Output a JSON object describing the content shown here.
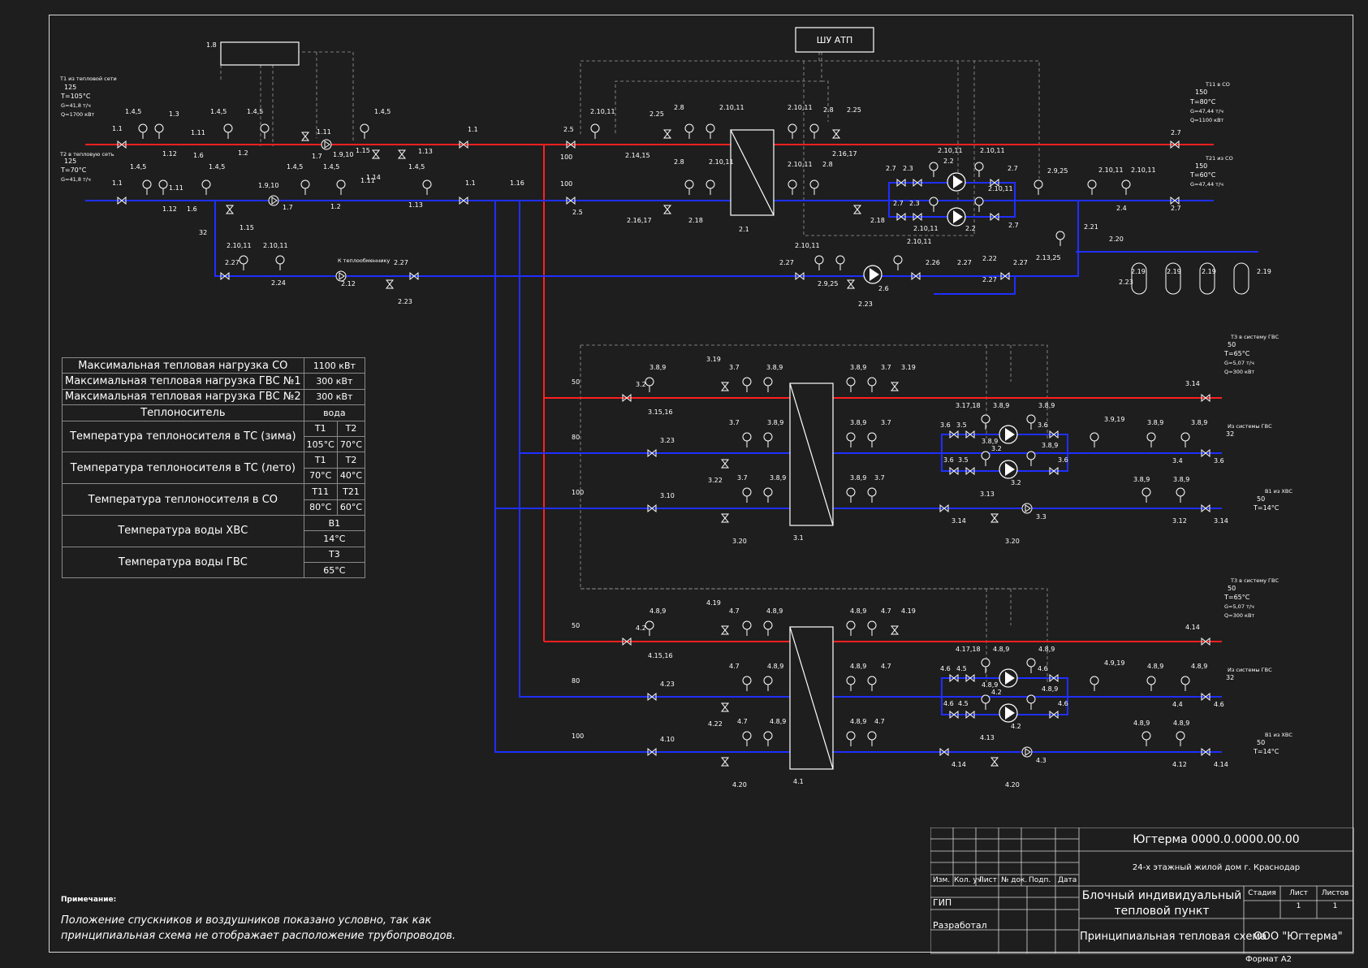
{
  "colors": {
    "background": "#1e1e1e",
    "supply": "#ff2020",
    "return": "#1f2fff",
    "control": "#9a9a9a",
    "frame": "#d9d9d9",
    "text": "#ffffff"
  },
  "atp_cabinet": "ШУ АТП",
  "heat_network": {
    "t1": {
      "caption": "Т1 из тепловой сети",
      "dn": "125",
      "temp": "Т=105°С",
      "flow": "G=41,8 т/ч",
      "load": "Q=1700 кВт"
    },
    "t2": {
      "caption": "Т2 в тепловую сеть",
      "dn": "125",
      "temp": "Т=70°С",
      "flow": "G=41,8 т/ч"
    }
  },
  "heating_circuit": {
    "t11": {
      "caption": "Т11 в СО",
      "dn": "150",
      "temp": "Т=80°С",
      "flow": "G=47,44 т/ч",
      "load": "Q=1100 кВт"
    },
    "t21": {
      "caption": "Т21 из СО",
      "dn": "150",
      "temp": "Т=60°С",
      "flow": "G=47,44 т/ч"
    }
  },
  "dhw1": {
    "t3": {
      "caption": "Т3 в систему ГВС",
      "dn": "50",
      "temp": "Т=65°С",
      "flow": "G=5,07 т/ч",
      "load": "Q=300 кВт"
    },
    "recirc": {
      "caption": "Из системы ГВС",
      "dn": "32"
    },
    "b1": {
      "caption": "В1 из ХВС",
      "dn": "50",
      "temp": "Т=14°С"
    }
  },
  "dhw2": {
    "t3": {
      "caption": "Т3 в систему ГВС",
      "dn": "50",
      "temp": "Т=65°С",
      "flow": "G=5,07 т/ч",
      "load": "Q=300 кВт"
    },
    "recirc": {
      "caption": "Из системы ГВС",
      "dn": "32"
    },
    "b1": {
      "caption": "В1 из ХВС",
      "dn": "50",
      "temp": "Т=14°С"
    }
  },
  "make_up_caption": "К теплообменнику",
  "pipe_dn": {
    "d32": "32",
    "d50": "50",
    "d80": "80",
    "d100": "100"
  },
  "params_table": {
    "max_load_co": {
      "label": "Максимальная тепловая нагрузка СО",
      "value": "1100 кВт"
    },
    "max_load_gvs1": {
      "label": "Максимальная тепловая нагрузка ГВС №1",
      "value": "300 кВт"
    },
    "max_load_gvs2": {
      "label": "Максимальная тепловая нагрузка ГВС №2",
      "value": "300 кВт"
    },
    "carrier": {
      "label": "Теплоноситель",
      "value": "вода"
    },
    "ts_winter": {
      "label": "Температура теплоносителя в ТС (зима)",
      "c1": "Т1",
      "c2": "Т2",
      "v1": "105°С",
      "v2": "70°С"
    },
    "ts_summer": {
      "label": "Температура теплоносителя в ТС (лето)",
      "c1": "Т1",
      "c2": "Т2",
      "v1": "70°С",
      "v2": "40°С"
    },
    "co_temp": {
      "label": "Температура теплоносителя в СО",
      "c1": "Т11",
      "c2": "Т21",
      "v1": "80°С",
      "v2": "60°С"
    },
    "xvs_temp": {
      "label": "Температура воды ХВС",
      "c1": "В1",
      "v1": "14°С"
    },
    "gvs_temp": {
      "label": "Температура воды ГВС",
      "c1": "Т3",
      "v1": "65°С"
    }
  },
  "note": {
    "title": "Примечание:",
    "text": "Положение спускников и воздушников показано условно, так как принципиальная схема не отображает расположение трубопроводов."
  },
  "stamp": {
    "code": "Югтерма 0000.0.0000.00.00",
    "object": "24-х этажный жилой дом г. Краснодар",
    "title": "Блочный индивидуальный тепловой пункт",
    "sheet_title": "Принципиальная тепловая схема",
    "company": "ООО \"Югтерма\"",
    "cols": {
      "izm": "Изм.",
      "kol": "Кол. уч.",
      "list": "Лист",
      "ndok": "№ док.",
      "podp": "Подп.",
      "data": "Дата"
    },
    "gip": "ГИП",
    "razrab": "Разработал",
    "stadiya": "Стадия",
    "list_label": "Лист",
    "listov_label": "Листов",
    "list_value": "1",
    "listov_value": "1",
    "format": "Формат А2"
  }
}
